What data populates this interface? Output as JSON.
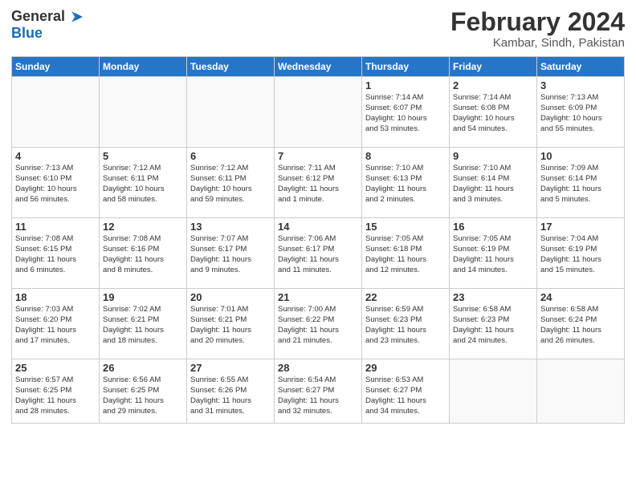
{
  "logo": {
    "general": "General",
    "blue": "Blue"
  },
  "title": "February 2024",
  "subtitle": "Kambar, Sindh, Pakistan",
  "days_of_week": [
    "Sunday",
    "Monday",
    "Tuesday",
    "Wednesday",
    "Thursday",
    "Friday",
    "Saturday"
  ],
  "weeks": [
    [
      {
        "day": "",
        "info": ""
      },
      {
        "day": "",
        "info": ""
      },
      {
        "day": "",
        "info": ""
      },
      {
        "day": "",
        "info": ""
      },
      {
        "day": "1",
        "info": "Sunrise: 7:14 AM\nSunset: 6:07 PM\nDaylight: 10 hours\nand 53 minutes."
      },
      {
        "day": "2",
        "info": "Sunrise: 7:14 AM\nSunset: 6:08 PM\nDaylight: 10 hours\nand 54 minutes."
      },
      {
        "day": "3",
        "info": "Sunrise: 7:13 AM\nSunset: 6:09 PM\nDaylight: 10 hours\nand 55 minutes."
      }
    ],
    [
      {
        "day": "4",
        "info": "Sunrise: 7:13 AM\nSunset: 6:10 PM\nDaylight: 10 hours\nand 56 minutes."
      },
      {
        "day": "5",
        "info": "Sunrise: 7:12 AM\nSunset: 6:11 PM\nDaylight: 10 hours\nand 58 minutes."
      },
      {
        "day": "6",
        "info": "Sunrise: 7:12 AM\nSunset: 6:11 PM\nDaylight: 10 hours\nand 59 minutes."
      },
      {
        "day": "7",
        "info": "Sunrise: 7:11 AM\nSunset: 6:12 PM\nDaylight: 11 hours\nand 1 minute."
      },
      {
        "day": "8",
        "info": "Sunrise: 7:10 AM\nSunset: 6:13 PM\nDaylight: 11 hours\nand 2 minutes."
      },
      {
        "day": "9",
        "info": "Sunrise: 7:10 AM\nSunset: 6:14 PM\nDaylight: 11 hours\nand 3 minutes."
      },
      {
        "day": "10",
        "info": "Sunrise: 7:09 AM\nSunset: 6:14 PM\nDaylight: 11 hours\nand 5 minutes."
      }
    ],
    [
      {
        "day": "11",
        "info": "Sunrise: 7:08 AM\nSunset: 6:15 PM\nDaylight: 11 hours\nand 6 minutes."
      },
      {
        "day": "12",
        "info": "Sunrise: 7:08 AM\nSunset: 6:16 PM\nDaylight: 11 hours\nand 8 minutes."
      },
      {
        "day": "13",
        "info": "Sunrise: 7:07 AM\nSunset: 6:17 PM\nDaylight: 11 hours\nand 9 minutes."
      },
      {
        "day": "14",
        "info": "Sunrise: 7:06 AM\nSunset: 6:17 PM\nDaylight: 11 hours\nand 11 minutes."
      },
      {
        "day": "15",
        "info": "Sunrise: 7:05 AM\nSunset: 6:18 PM\nDaylight: 11 hours\nand 12 minutes."
      },
      {
        "day": "16",
        "info": "Sunrise: 7:05 AM\nSunset: 6:19 PM\nDaylight: 11 hours\nand 14 minutes."
      },
      {
        "day": "17",
        "info": "Sunrise: 7:04 AM\nSunset: 6:19 PM\nDaylight: 11 hours\nand 15 minutes."
      }
    ],
    [
      {
        "day": "18",
        "info": "Sunrise: 7:03 AM\nSunset: 6:20 PM\nDaylight: 11 hours\nand 17 minutes."
      },
      {
        "day": "19",
        "info": "Sunrise: 7:02 AM\nSunset: 6:21 PM\nDaylight: 11 hours\nand 18 minutes."
      },
      {
        "day": "20",
        "info": "Sunrise: 7:01 AM\nSunset: 6:21 PM\nDaylight: 11 hours\nand 20 minutes."
      },
      {
        "day": "21",
        "info": "Sunrise: 7:00 AM\nSunset: 6:22 PM\nDaylight: 11 hours\nand 21 minutes."
      },
      {
        "day": "22",
        "info": "Sunrise: 6:59 AM\nSunset: 6:23 PM\nDaylight: 11 hours\nand 23 minutes."
      },
      {
        "day": "23",
        "info": "Sunrise: 6:58 AM\nSunset: 6:23 PM\nDaylight: 11 hours\nand 24 minutes."
      },
      {
        "day": "24",
        "info": "Sunrise: 6:58 AM\nSunset: 6:24 PM\nDaylight: 11 hours\nand 26 minutes."
      }
    ],
    [
      {
        "day": "25",
        "info": "Sunrise: 6:57 AM\nSunset: 6:25 PM\nDaylight: 11 hours\nand 28 minutes."
      },
      {
        "day": "26",
        "info": "Sunrise: 6:56 AM\nSunset: 6:25 PM\nDaylight: 11 hours\nand 29 minutes."
      },
      {
        "day": "27",
        "info": "Sunrise: 6:55 AM\nSunset: 6:26 PM\nDaylight: 11 hours\nand 31 minutes."
      },
      {
        "day": "28",
        "info": "Sunrise: 6:54 AM\nSunset: 6:27 PM\nDaylight: 11 hours\nand 32 minutes."
      },
      {
        "day": "29",
        "info": "Sunrise: 6:53 AM\nSunset: 6:27 PM\nDaylight: 11 hours\nand 34 minutes."
      },
      {
        "day": "",
        "info": ""
      },
      {
        "day": "",
        "info": ""
      }
    ]
  ]
}
